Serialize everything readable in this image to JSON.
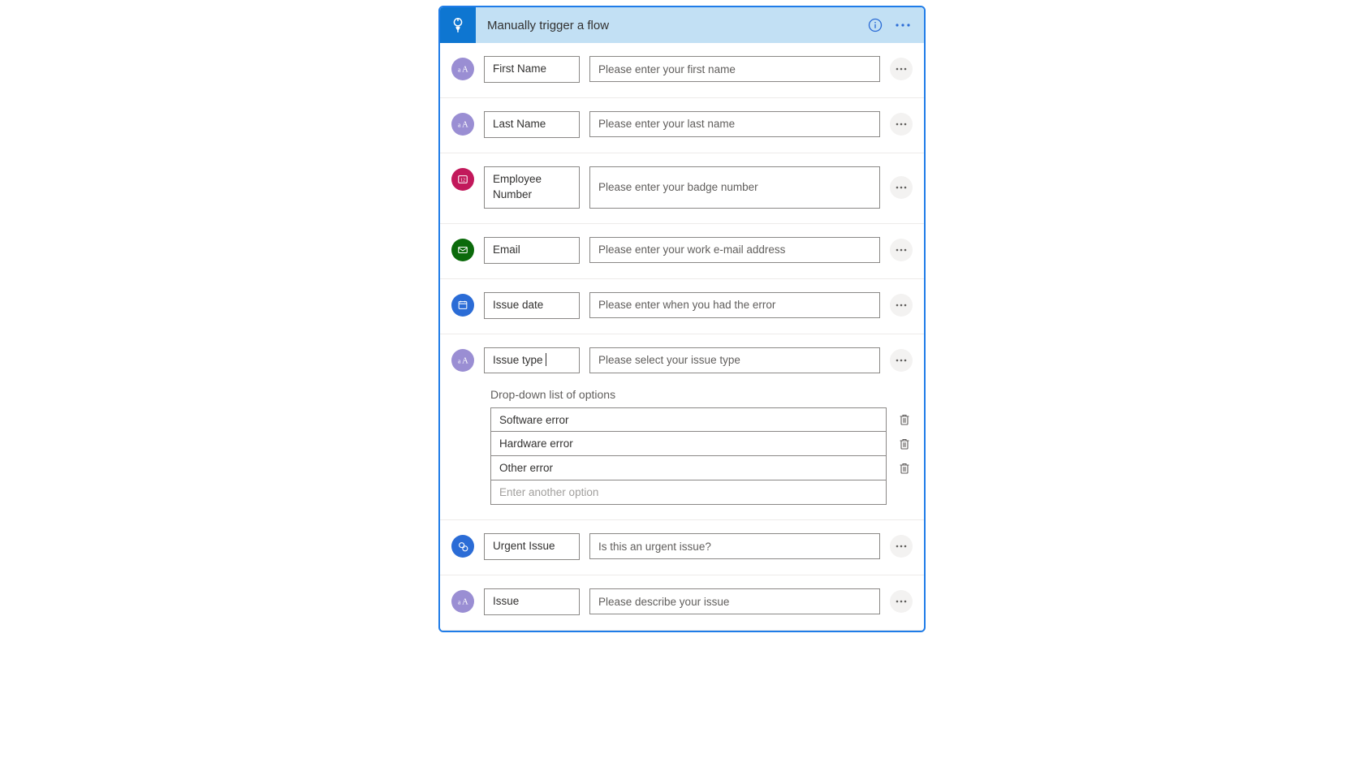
{
  "header": {
    "title": "Manually trigger a flow"
  },
  "rows": {
    "firstName": {
      "label": "First Name",
      "desc": "Please enter your first name",
      "iconBg": "#9a8ed3",
      "iconType": "text"
    },
    "lastName": {
      "label": "Last Name",
      "desc": "Please enter your last name",
      "iconBg": "#9a8ed3",
      "iconType": "text"
    },
    "employeeNum": {
      "label": "Employee Number",
      "desc": "Please enter your badge number",
      "iconBg": "#c2185b",
      "iconType": "number"
    },
    "email": {
      "label": "Email",
      "desc": "Please enter your work e-mail address",
      "iconBg": "#0b6a0b",
      "iconType": "email"
    },
    "issueDate": {
      "label": "Issue date",
      "desc": "Please enter when you had the error",
      "iconBg": "#2b6cd6",
      "iconType": "date"
    },
    "issueType": {
      "label": "Issue type",
      "desc": "Please select your issue type",
      "iconBg": "#9a8ed3",
      "iconType": "text"
    },
    "urgent": {
      "label": "Urgent Issue",
      "desc": "Is this an urgent issue?",
      "iconBg": "#2b6cd6",
      "iconType": "yesno"
    },
    "issue": {
      "label": "Issue",
      "desc": "Please describe your issue",
      "iconBg": "#9a8ed3",
      "iconType": "text"
    }
  },
  "dropdown": {
    "label": "Drop-down list of options",
    "options": [
      "Software error",
      "Hardware error",
      "Other error"
    ],
    "newPlaceholder": "Enter another option"
  }
}
